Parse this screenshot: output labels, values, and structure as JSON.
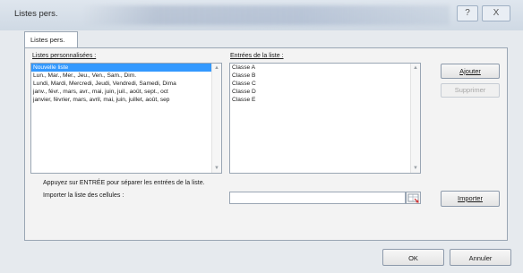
{
  "window": {
    "title": "Listes pers."
  },
  "titlebar": {
    "help": "?",
    "close": "X"
  },
  "tab": {
    "label": "Listes pers."
  },
  "custom_lists": {
    "label": "Listes personnalisées :",
    "items": [
      "Nouvelle liste",
      "Lun., Mar., Mer., Jeu., Ven., Sam., Dim.",
      "Lundi, Mardi, Mercredi, Jeudi, Vendredi, Samedi, Dima",
      "janv., févr., mars, avr., mai, juin, juil., août, sept., oct",
      "janvier, février, mars, avril, mai, juin, juillet, août, sep"
    ],
    "selected_index": 0
  },
  "entries": {
    "label": "Entrées de la liste :",
    "items": [
      "Classe A",
      "Classe B",
      "Classe C",
      "Classe D",
      "Classe E"
    ]
  },
  "buttons": {
    "add": "Ajouter",
    "delete": "Supprimer",
    "import": "Importer",
    "ok": "OK",
    "cancel": "Annuler"
  },
  "hint": "Appuyez sur ENTRÉE pour séparer les entrées de la liste.",
  "import": {
    "label": "Importer la liste des cellules :",
    "value": ""
  },
  "colors": {
    "selection": "#3399ff",
    "panel": "#f3f3f3",
    "titlebar": "#d6dee8"
  },
  "icons": {
    "help": "question-icon",
    "close": "close-icon",
    "picker": "range-picker-icon"
  }
}
